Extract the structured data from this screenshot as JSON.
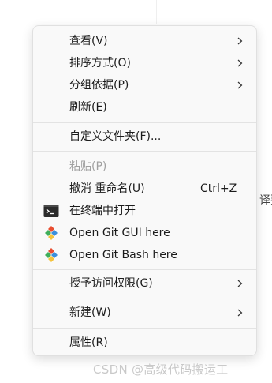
{
  "background": {
    "partial_text": "译要",
    "watermark": "CSDN @高级代码搬运工"
  },
  "menu": {
    "view": "查看(V)",
    "sort": "排序方式(O)",
    "group": "分组依据(P)",
    "refresh": "刷新(E)",
    "customize": "自定义文件夹(F)...",
    "paste": "粘贴(P)",
    "undo": "撤消 重命名(U)",
    "undo_shortcut": "Ctrl+Z",
    "terminal": "在终端中打开",
    "git_gui": "Open Git GUI here",
    "git_bash": "Open Git Bash here",
    "access": "授予访问权限(G)",
    "new": "新建(W)",
    "properties": "属性(R)"
  },
  "colors": {
    "menu_bg": "#f9f9f9",
    "disabled_text": "#a0a0a0",
    "git_red": "#e94e31",
    "git_green": "#3fae5a",
    "git_blue": "#3b8fdc",
    "git_yellow": "#f5c33b",
    "terminal_bg": "#2b2b2b"
  },
  "icons": {
    "terminal": "terminal-icon",
    "git": "git-icon",
    "submenu": "chevron-right-icon"
  }
}
